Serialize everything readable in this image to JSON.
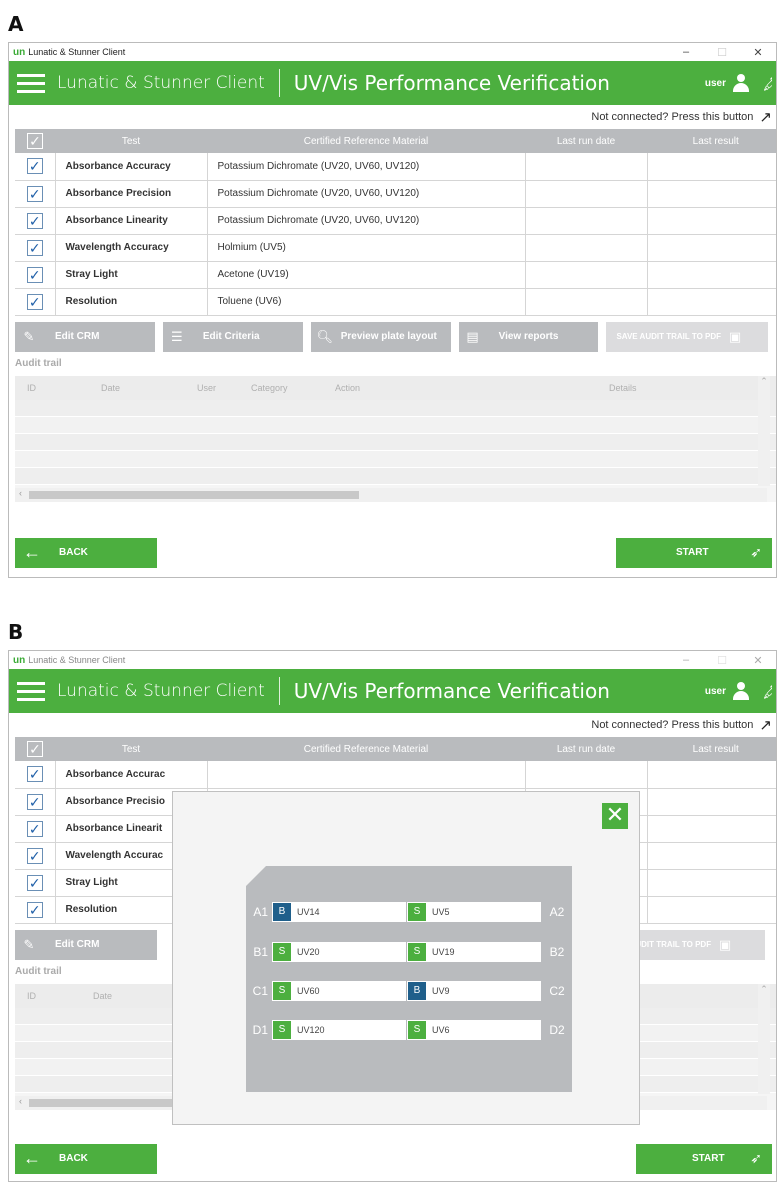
{
  "panels": [
    {
      "label": "A",
      "window": {
        "title_logo": "un",
        "title": "Lunatic & Stunner Client",
        "controls": [
          "–",
          "☐",
          "✕"
        ]
      },
      "header": {
        "app_name": "Lunatic & Stunner Client",
        "title": "UV/Vis Performance Verification",
        "user": "user"
      },
      "connect_text": "Not connected? Press this button",
      "table": {
        "columns": [
          "Test",
          "Certified Reference Material",
          "Last run date",
          "Last result"
        ],
        "rows": [
          {
            "test": "Absorbance Accuracy",
            "crm": "Potassium Dichromate (UV20, UV60, UV120)"
          },
          {
            "test": "Absorbance Precision",
            "crm": "Potassium Dichromate (UV20, UV60, UV120)"
          },
          {
            "test": "Absorbance Linearity",
            "crm": "Potassium Dichromate (UV20, UV60, UV120)"
          },
          {
            "test": "Wavelength Accuracy",
            "crm": "Holmium (UV5)"
          },
          {
            "test": "Stray Light",
            "crm": "Acetone (UV19)"
          },
          {
            "test": "Resolution",
            "crm": "Toluene (UV6)"
          }
        ]
      },
      "toolbar": {
        "edit_crm": "Edit CRM",
        "edit_criteria": "Edit Criteria",
        "preview": "Preview plate layout",
        "view_reports": "View reports",
        "save_audit": "SAVE AUDIT TRAIL TO PDF"
      },
      "audit": {
        "label": "Audit trail",
        "columns": [
          "ID",
          "Date",
          "User",
          "Category",
          "Action",
          "Details"
        ]
      },
      "footer": {
        "back": "BACK",
        "start": "START"
      }
    },
    {
      "label": "B",
      "window": {
        "title_logo": "un",
        "title": "Lunatic & Stunner Client",
        "controls": [
          "–",
          "☐",
          "✕"
        ]
      },
      "header": {
        "app_name": "Lunatic & Stunner Client",
        "title": "UV/Vis Performance Verification",
        "user": "user"
      },
      "connect_text": "Not connected? Press this button",
      "table": {
        "columns": [
          "Test",
          "Certified Reference Material",
          "Last run date",
          "Last result"
        ],
        "rows": [
          {
            "test": "Absorbance Accurac",
            "crm": ""
          },
          {
            "test": "Absorbance Precisio",
            "crm": ""
          },
          {
            "test": "Absorbance Linearit",
            "crm": ""
          },
          {
            "test": "Wavelength Accurac",
            "crm": ""
          },
          {
            "test": "Stray Light",
            "crm": ""
          },
          {
            "test": "Resolution",
            "crm": ""
          }
        ]
      },
      "toolbar": {
        "edit_crm": "Edit CRM",
        "save_audit": "VE AUDIT TRAIL TO PDF"
      },
      "audit": {
        "label": "Audit trail",
        "columns": [
          "ID",
          "Date"
        ]
      },
      "footer": {
        "back": "BACK",
        "start": "START"
      },
      "plate_dialog": {
        "close": "✕",
        "rows": [
          {
            "left_pos": "A1",
            "left_type": "B",
            "left_name": "UV14",
            "right_type": "S",
            "right_name": "UV5",
            "right_pos": "A2"
          },
          {
            "left_pos": "B1",
            "left_type": "S",
            "left_name": "UV20",
            "right_type": "S",
            "right_name": "UV19",
            "right_pos": "B2"
          },
          {
            "left_pos": "C1",
            "left_type": "S",
            "left_name": "UV60",
            "right_type": "B",
            "right_name": "UV9",
            "right_pos": "C2"
          },
          {
            "left_pos": "D1",
            "left_type": "S",
            "left_name": "UV120",
            "right_type": "S",
            "right_name": "UV6",
            "right_pos": "D2"
          }
        ]
      }
    }
  ],
  "colors": {
    "accent_green": "#4caf3f",
    "header_gray": "#b9bbbe",
    "blank_blue": "#1f5f8b"
  },
  "icons": {
    "check": "✓",
    "arrow": "↗",
    "back_arrow": "←",
    "rocket": "🚀"
  }
}
